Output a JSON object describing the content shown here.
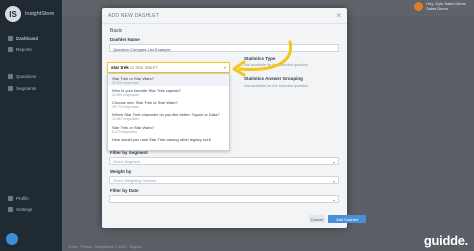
{
  "app": {
    "logo_text": "InsightStore",
    "logo_badge": "IS"
  },
  "sidebar": {
    "items": [
      {
        "label": "Dashboard"
      },
      {
        "label": "Reports"
      },
      {
        "label": "Questions"
      },
      {
        "label": "Segments"
      },
      {
        "label": "Profile"
      },
      {
        "label": "Settings"
      }
    ]
  },
  "topbar": {
    "user_name": "Hey, Kyle Sales Demo",
    "user_sub": "Sales Demo"
  },
  "modal": {
    "title": "ADD NEW DASHLET",
    "section": "Basic",
    "dashlet_name_label": "Dashlet Name",
    "dashlet_name_value": "Question Compare List Example",
    "statistics_label": "Statistics Type",
    "statistics_hint": "Not available for the selected question",
    "answer_grouping_label": "Statistics Answer Grouping",
    "answer_grouping_hint": "Not available for the selected question",
    "filter_segment_label": "Filter by Segment",
    "filter_segment_placeholder": "Select Segment",
    "weight_label": "Weight by",
    "weight_placeholder": "Select Weighting Scheme",
    "filter_date_label": "Filter by Date",
    "filter_date_placeholder": "",
    "cancel_label": "Cancel",
    "add_label": "Add Dashlet"
  },
  "search": {
    "typed": "star trek",
    "rest": "or Star Wars?"
  },
  "dropdown": {
    "items": [
      {
        "text": "Star Trek or Star Wars?",
        "sub": "49,300 responses"
      },
      {
        "text": "Who is your favorite Star Trek captain?",
        "sub": "43,891 responses"
      },
      {
        "text": "Choose one: Star Trek or Star Wars?",
        "sub": "39,776 responses"
      },
      {
        "text": "Which Star Trek character do you like better: Spock or Data?",
        "sub": "10,667 responses"
      },
      {
        "text": "Star Trek or Star Wars?",
        "sub": "8,473 responses"
      },
      {
        "text": "How would you rank Star Trek among other legacy sci-fi",
        "sub": ""
      }
    ]
  },
  "branding": {
    "guidde": "guidde."
  },
  "footer": {
    "text": "Terms · Privacy · InsightStore © 2023 · Support"
  },
  "colors": {
    "accent": "#f5c518",
    "primary_button": "#4a90d9"
  }
}
